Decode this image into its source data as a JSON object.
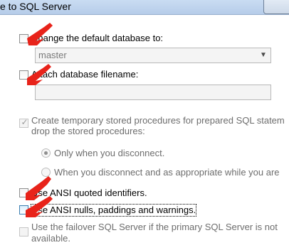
{
  "window": {
    "title": "e to SQL Server"
  },
  "options": {
    "change_default_db": {
      "label": "Change the default database to:",
      "checked": false
    },
    "default_db_select": {
      "value": "master"
    },
    "attach_db": {
      "label": "Attach database filename:",
      "checked": false
    },
    "attach_db_field": {
      "value": ""
    },
    "temp_procs": {
      "label_line1": "Create temporary stored procedures for prepared SQL statem",
      "label_line2": "drop the stored procedures:",
      "checked": true
    },
    "radio_only_disconnect": {
      "label": "Only when you disconnect.",
      "selected": true
    },
    "radio_disconnect_appropriate": {
      "label": "When you disconnect and as appropriate while you are",
      "selected": false
    },
    "quoted_identifiers": {
      "label": "Use ANSI quoted identifiers.",
      "checked": false
    },
    "ansi_nulls": {
      "label": "Use ANSI nulls, paddings and warnings.",
      "checked": false
    },
    "failover": {
      "label_line1": "Use the failover SQL Server if the primary SQL Server is not",
      "label_line2": "available.",
      "checked": false
    }
  },
  "colors": {
    "annotation_arrow": "#e8231a"
  }
}
